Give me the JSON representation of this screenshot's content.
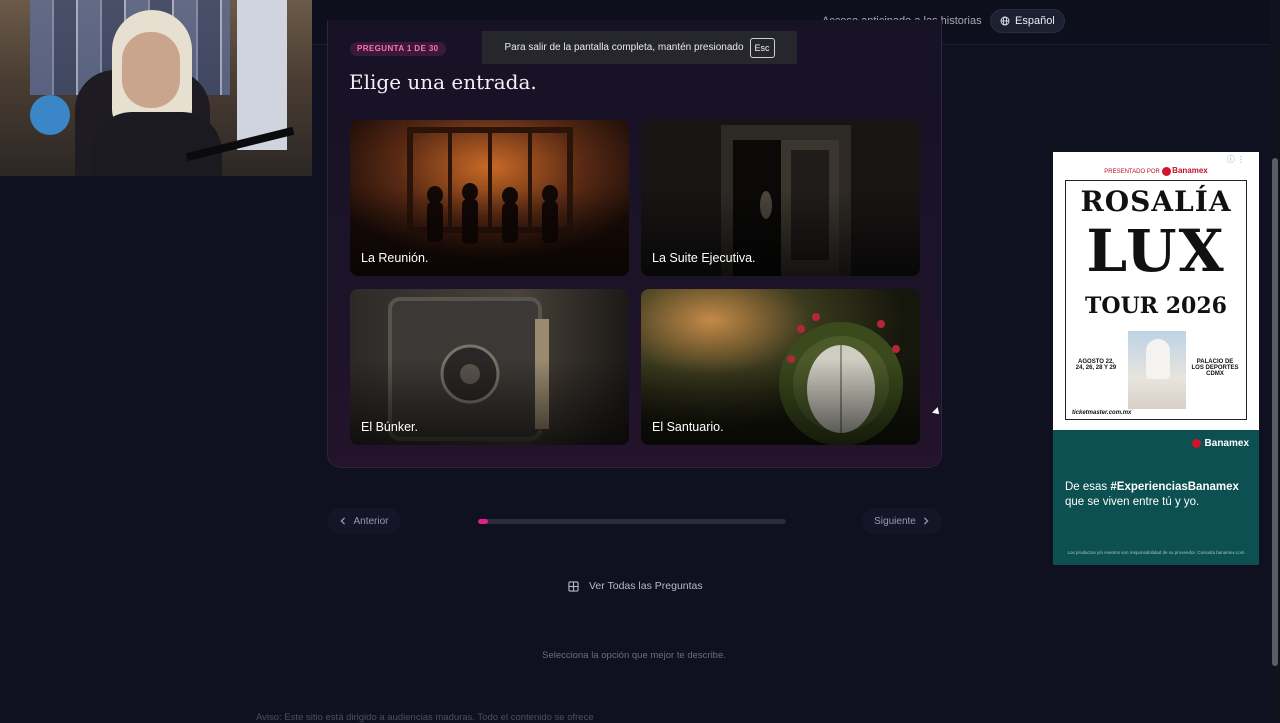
{
  "header": {
    "early_access_link": "Acceso anticipado a las historias",
    "language_label": "Español",
    "language_icon": "globe-icon"
  },
  "fullscreen_toast": {
    "message": "Para salir de la pantalla completa, mantén presionado",
    "key": "Esc"
  },
  "quiz": {
    "badge": "PREGUNTA 1 DE 30",
    "title": "Elige una entrada.",
    "options": [
      {
        "label": "La Reunión.",
        "art": "party-silhouettes"
      },
      {
        "label": "La Suite Ejecutiva.",
        "art": "dark-doorway"
      },
      {
        "label": "El Búnker.",
        "art": "vault-door"
      },
      {
        "label": "El Santuario.",
        "art": "garden-round-door"
      }
    ]
  },
  "navigation": {
    "prev_label": "Anterior",
    "next_label": "Siguiente",
    "progress_fraction": 0.033,
    "progress_color": "#e0208a",
    "all_questions_label": "Ver Todas las Preguntas",
    "all_questions_icon": "grid-icon"
  },
  "footer": {
    "hint": "Selecciona la opción que mejor te describe.",
    "disclaimer": "Aviso: Este sitio está dirigido a audiencias maduras. Todo el contenido se ofrece"
  },
  "ad": {
    "presented_by": "PRESENTADO POR",
    "sponsor": "Banamex",
    "headline_1": "ROSALÍA",
    "headline_2": "LUX",
    "headline_3": "TOUR 2026",
    "dates": "AGOSTO 22, 24, 26, 28 Y 29",
    "venue": "PALACIO DE LOS DEPORTES CDMX",
    "ticket_site": "ticketmaster.com.mx",
    "slogan_prefix": "De esas ",
    "slogan_hashtag": "#ExperienciasBanamex",
    "slogan_suffix": " que se viven entre tú y yo.",
    "fine_print": "Los productos y/o eventos son responsabilidad de su proveedor. Consulta banamex.com",
    "brand_color": "#0d5051"
  }
}
